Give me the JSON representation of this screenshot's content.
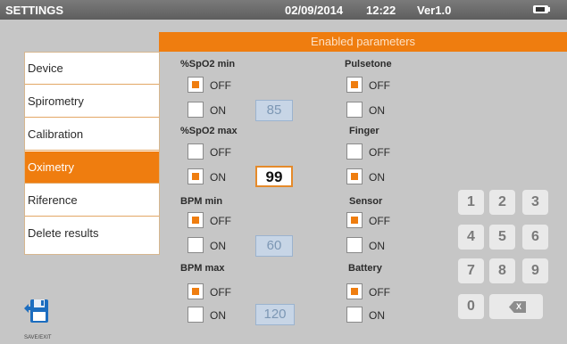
{
  "header": {
    "title": "SETTINGS",
    "date": "02/09/2014",
    "time": "12:22",
    "version": "Ver1.0"
  },
  "section_title": "Enabled parameters",
  "sidebar": {
    "items": [
      {
        "label": "Device"
      },
      {
        "label": "Spirometry"
      },
      {
        "label": "Calibration"
      },
      {
        "label": "Oximetry"
      },
      {
        "label": "Riference"
      },
      {
        "label": "Delete results"
      }
    ],
    "active": "Oximetry"
  },
  "params": {
    "spo2_min": {
      "title": "%SpO2 min",
      "off": "OFF",
      "on": "ON",
      "selected": "OFF",
      "value": "85"
    },
    "spo2_max": {
      "title": "%SpO2 max",
      "off": "OFF",
      "on": "ON",
      "selected": "ON",
      "value": "99"
    },
    "bpm_min": {
      "title": "BPM min",
      "off": "OFF",
      "on": "ON",
      "selected": "OFF",
      "value": "60"
    },
    "bpm_max": {
      "title": "BPM max",
      "off": "OFF",
      "on": "ON",
      "selected": "OFF",
      "value": "120"
    },
    "pulsetone": {
      "title": "Pulsetone",
      "off": "OFF",
      "on": "ON",
      "selected": "OFF"
    },
    "finger": {
      "title": "Finger",
      "off": "OFF",
      "on": "ON",
      "selected": "ON"
    },
    "sensor": {
      "title": "Sensor",
      "off": "OFF",
      "on": "ON",
      "selected": "OFF"
    },
    "battery": {
      "title": "Battery",
      "off": "OFF",
      "on": "ON",
      "selected": "OFF"
    }
  },
  "keypad": {
    "keys": [
      "1",
      "2",
      "3",
      "4",
      "5",
      "6",
      "7",
      "8",
      "9",
      "0"
    ],
    "backspace_glyph": "X"
  },
  "footer": {
    "save_label": "SAVE/EXIT"
  },
  "colors": {
    "accent": "#ef7d0f",
    "title_bar": "#666666",
    "panel": "#c6c6c6"
  }
}
